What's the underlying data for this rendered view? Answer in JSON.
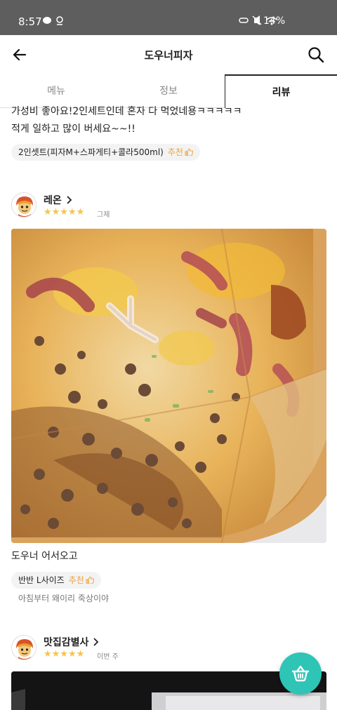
{
  "status_bar": {
    "time": "8:57",
    "battery": "14%"
  },
  "header": {
    "title": "도우너피자"
  },
  "tabs": [
    {
      "label": "메뉴"
    },
    {
      "label": "정보"
    },
    {
      "label": "리뷰"
    }
  ],
  "reviews": [
    {
      "text_line1": "가성비 좋아요!2인세트인데 혼자 다 먹었네용ㅋㅋㅋㅋㅋ",
      "text_line2": "적게 일하고 많이 버세요~~!!",
      "menu_chip": "2인셋트(피자M+스파게티+콜라500ml)",
      "recommend": "추천"
    },
    {
      "author": "레온",
      "stars": "★★★★★",
      "date": "그제",
      "text": "도우너 어서오고",
      "menu_chip": "반반 L사이즈",
      "recommend": "추천",
      "sub_note": "아침부터 왜이리 죽상이야"
    },
    {
      "author": "맛집감별사",
      "stars": "★★★★★",
      "date": "이번 주"
    }
  ],
  "colors": {
    "accent": "#2ec4b6",
    "star": "#f6c544",
    "recommend": "#f0a13b"
  },
  "icons": [
    "back-arrow-icon",
    "search-icon",
    "cart-icon",
    "thumbs-up-icon",
    "chevron-right-icon"
  ]
}
